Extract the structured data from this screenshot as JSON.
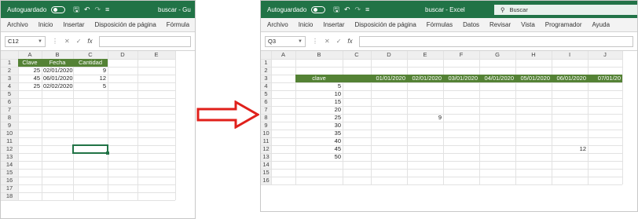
{
  "left": {
    "titlebar": {
      "autosave_label": "Autoguardado",
      "doc_title": "buscar - Gu"
    },
    "ribbon_tabs": [
      "Archivo",
      "Inicio",
      "Insertar",
      "Disposición de página",
      "Fórmula"
    ],
    "name_box": "C12",
    "columns": [
      "A",
      "B",
      "C",
      "D",
      "E"
    ],
    "rows": [
      "1",
      "2",
      "3",
      "4",
      "5",
      "6",
      "7",
      "8",
      "9",
      "10",
      "11",
      "12",
      "13",
      "14",
      "15",
      "16",
      "17",
      "18"
    ],
    "table": {
      "headers": [
        "Clave",
        "Fecha",
        "Cantidad"
      ],
      "rows": [
        [
          "25",
          "02/01/2020",
          "9"
        ],
        [
          "45",
          "06/01/2020",
          "12"
        ],
        [
          "25",
          "02/02/2020",
          "5"
        ]
      ]
    }
  },
  "right": {
    "titlebar": {
      "autosave_label": "Autoguardado",
      "doc_title": "buscar - Excel",
      "search_placeholder": "Buscar"
    },
    "ribbon_tabs": [
      "Archivo",
      "Inicio",
      "Insertar",
      "Disposición de página",
      "Fórmulas",
      "Datos",
      "Revisar",
      "Vista",
      "Programador",
      "Ayuda"
    ],
    "name_box": "Q3",
    "columns": [
      "A",
      "B",
      "C",
      "D",
      "E",
      "F",
      "G",
      "H",
      "I",
      "J"
    ],
    "rows": [
      "1",
      "2",
      "3",
      "4",
      "5",
      "6",
      "7",
      "8",
      "9",
      "10",
      "11",
      "12",
      "13",
      "14",
      "15",
      "16"
    ],
    "header_row": {
      "clave_label": "clave",
      "dates": [
        "01/01/2020",
        "02/01/2020",
        "03/01/2020",
        "04/01/2020",
        "05/01/2020",
        "06/01/2020",
        "07/01/20"
      ]
    },
    "claves": [
      "5",
      "10",
      "15",
      "20",
      "25",
      "30",
      "35",
      "40",
      "45",
      "50"
    ],
    "values": {
      "E8": "9",
      "I12": "12"
    }
  },
  "colors": {
    "excel_green": "#217346",
    "table_header_green": "#548235",
    "arrow_red": "#e0201b"
  }
}
